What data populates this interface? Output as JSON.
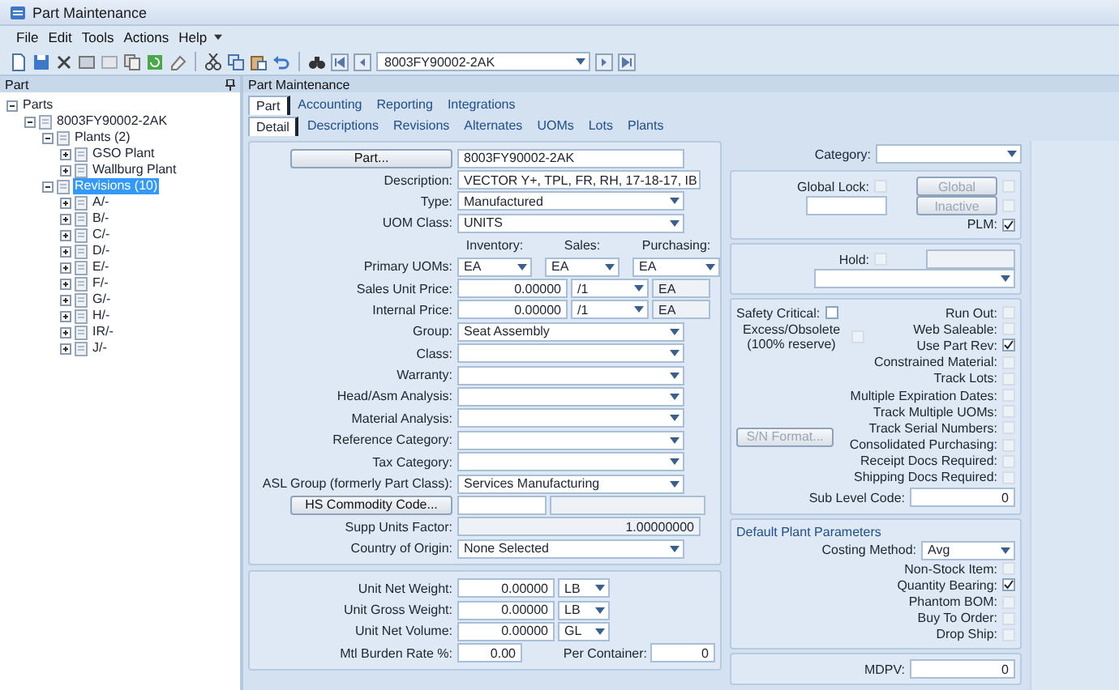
{
  "window": {
    "title": "Part Maintenance"
  },
  "menu": [
    "File",
    "Edit",
    "Tools",
    "Actions",
    "Help"
  ],
  "toolbar": {
    "record": "8003FY90002-2AK"
  },
  "tree_panel": {
    "title": "Part",
    "tree": [
      {
        "label": "Parts",
        "expanded": true,
        "selected": false,
        "children": [
          {
            "label": "8003FY90002-2AK",
            "expanded": true,
            "selected": false,
            "children": [
              {
                "label": "Plants (2)",
                "expanded": true,
                "selected": false,
                "children": [
                  {
                    "label": "GSO Plant",
                    "expanded": false,
                    "selected": false
                  },
                  {
                    "label": "Wallburg Plant",
                    "expanded": false,
                    "selected": false
                  }
                ]
              },
              {
                "label": "Revisions (10)",
                "expanded": true,
                "selected": true,
                "children": [
                  {
                    "label": "A/-",
                    "expanded": false,
                    "selected": false
                  },
                  {
                    "label": "B/-",
                    "expanded": false,
                    "selected": false
                  },
                  {
                    "label": "C/-",
                    "expanded": false,
                    "selected": false
                  },
                  {
                    "label": "D/-",
                    "expanded": false,
                    "selected": false
                  },
                  {
                    "label": "E/-",
                    "expanded": false,
                    "selected": false
                  },
                  {
                    "label": "F/-",
                    "expanded": false,
                    "selected": false
                  },
                  {
                    "label": "G/-",
                    "expanded": false,
                    "selected": false
                  },
                  {
                    "label": "H/-",
                    "expanded": false,
                    "selected": false
                  },
                  {
                    "label": "IR/-",
                    "expanded": false,
                    "selected": false
                  },
                  {
                    "label": "J/-",
                    "expanded": false,
                    "selected": false
                  }
                ]
              }
            ]
          }
        ]
      }
    ]
  },
  "main_panel": {
    "title": "Part Maintenance",
    "tabs": [
      {
        "label": "Part",
        "selected": true
      },
      {
        "label": "Accounting",
        "selected": false
      },
      {
        "label": "Reporting",
        "selected": false
      },
      {
        "label": "Integrations",
        "selected": false
      }
    ],
    "subtabs": [
      {
        "label": "Detail",
        "selected": true
      },
      {
        "label": "Descriptions",
        "selected": false
      },
      {
        "label": "Revisions",
        "selected": false
      },
      {
        "label": "Alternates",
        "selected": false
      },
      {
        "label": "UOMs",
        "selected": false
      },
      {
        "label": "Lots",
        "selected": false
      },
      {
        "label": "Plants",
        "selected": false
      }
    ]
  },
  "detail": {
    "main_fields": [
      {
        "kind": "button_field",
        "button": "Part...",
        "value": "8003FY90002-2AK"
      },
      {
        "kind": "text",
        "label": "Description:",
        "value": "VECTOR Y+, TPL, FR, RH, 17-18-17, IB"
      },
      {
        "kind": "select",
        "label": "Type:",
        "value": "Manufactured"
      },
      {
        "kind": "select",
        "label": "UOM Class:",
        "value": "UNITS"
      },
      {
        "kind": "headers",
        "items": [
          "Inventory:",
          "Sales:",
          "Purchasing:"
        ]
      },
      {
        "kind": "uoms",
        "label": "Primary UOMs:",
        "values": [
          "EA",
          "EA",
          "EA"
        ]
      },
      {
        "kind": "price",
        "label": "Sales Unit Price:",
        "value": "0.00000",
        "per": "/1",
        "uom": "EA"
      },
      {
        "kind": "price",
        "label": "Internal Price:",
        "value": "0.00000",
        "per": "/1",
        "uom": "EA"
      },
      {
        "kind": "select",
        "label": "Group:",
        "value": "Seat Assembly"
      },
      {
        "kind": "select",
        "label": "Class:"
      },
      {
        "kind": "select",
        "label": "Warranty:"
      },
      {
        "kind": "select",
        "label": "Head/Asm Analysis:"
      },
      {
        "kind": "select",
        "label": "Material Analysis:"
      },
      {
        "kind": "select",
        "label": "Reference Category:"
      },
      {
        "kind": "select",
        "label": "Tax Category:"
      },
      {
        "kind": "select",
        "label": "ASL Group (formerly Part Class):",
        "value": "Services Manufacturing"
      },
      {
        "kind": "button_pair",
        "button": "HS Commodity Code..."
      },
      {
        "kind": "number",
        "label": "Supp Units Factor:",
        "value": "1.00000000"
      },
      {
        "kind": "select",
        "label": "Country of Origin:",
        "value": "None Selected"
      }
    ],
    "measure_fields": [
      {
        "kind": "measure",
        "label": "Unit Net Weight:",
        "value": "0.00000",
        "unit": "LB"
      },
      {
        "kind": "measure",
        "label": "Unit Gross Weight:",
        "value": "0.00000",
        "unit": "LB"
      },
      {
        "kind": "measure",
        "label": "Unit Net Volume:",
        "value": "0.00000",
        "unit": "GL"
      },
      {
        "kind": "burden",
        "label": "Mtl Burden Rate %:",
        "value": "0.00",
        "label2": "Per Container:",
        "value2": "0"
      }
    ],
    "category": {
      "label": "Category:"
    },
    "global": {
      "lock_label": "Global Lock:",
      "lock_checked": false,
      "global_button": "Global",
      "global_checked": false,
      "inactive_button": "Inactive",
      "inactive_checked": false,
      "plm_label": "PLM:",
      "plm_checked": true
    },
    "hold": {
      "label": "Hold:",
      "checked": false
    },
    "flags": {
      "left": [
        {
          "label": "Safety Critical:",
          "checked": false,
          "disabled": false
        },
        {
          "label": "Excess/Obsolete (100% reserve)",
          "checked": false,
          "disabled": true
        }
      ],
      "sn_button": "S/N Format...",
      "right": [
        {
          "label": "Run Out:",
          "checked": false,
          "disabled": true
        },
        {
          "label": "Web Saleable:",
          "checked": false,
          "disabled": true
        },
        {
          "label": "Use Part Rev:",
          "checked": true,
          "disabled": false
        },
        {
          "label": "Constrained Material:",
          "checked": false,
          "disabled": true
        },
        {
          "label": "Track Lots:",
          "checked": false,
          "disabled": true
        },
        {
          "label": "Multiple Expiration Dates:",
          "checked": false,
          "disabled": true
        },
        {
          "label": "Track Multiple UOMs:",
          "checked": false,
          "disabled": true
        },
        {
          "label": "Track Serial Numbers:",
          "checked": false,
          "disabled": true
        },
        {
          "label": "Consolidated Purchasing:",
          "checked": false,
          "disabled": true
        },
        {
          "label": "Receipt Docs Required:",
          "checked": false,
          "disabled": true
        },
        {
          "label": "Shipping Docs Required:",
          "checked": false,
          "disabled": true
        }
      ],
      "sub_level_label": "Sub Level Code:",
      "sub_level_value": "0"
    },
    "plant_parameters": {
      "title": "Default Plant Parameters",
      "costing_label": "Costing Method:",
      "costing_value": "Avg",
      "flags": [
        {
          "label": "Non-Stock Item:",
          "checked": false,
          "disabled": true
        },
        {
          "label": "Quantity Bearing:",
          "checked": true,
          "disabled": false
        },
        {
          "label": "Phantom BOM:",
          "checked": false,
          "disabled": true
        },
        {
          "label": "Buy To Order:",
          "checked": false,
          "disabled": true
        },
        {
          "label": "Drop Ship:",
          "checked": false,
          "disabled": true
        }
      ]
    },
    "mdpv": {
      "label": "MDPV:",
      "value": "0"
    }
  }
}
